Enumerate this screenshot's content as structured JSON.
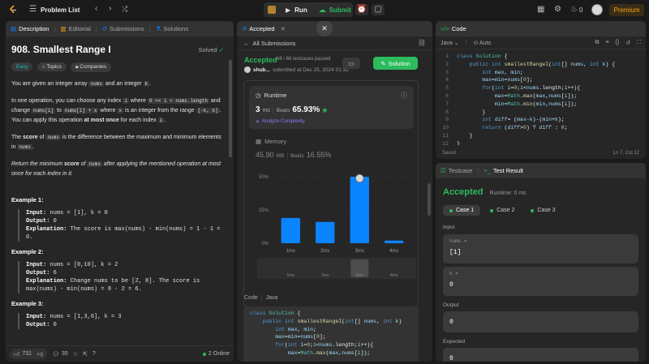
{
  "topbar": {
    "problem_list": "Problem List",
    "run": "Run",
    "submit": "Submit",
    "streak": "0",
    "premium": "Premium"
  },
  "left": {
    "tabs": [
      {
        "label": "Description"
      },
      {
        "label": "Editorial"
      },
      {
        "label": "Submissions"
      },
      {
        "label": "Solutions"
      }
    ],
    "title": "908. Smallest Range I",
    "status": "Solved",
    "chips": [
      "Easy",
      "Topics",
      "Companies"
    ],
    "p1": {
      "a": "You are given an integer array ",
      "b": "nums",
      "c": " and an integer ",
      "d": "k",
      "e": "."
    },
    "p2": {
      "a": "In one operation, you can choose any index ",
      "b": "i",
      "c": " where ",
      "d": "0 <= i < nums.length",
      "e": " and change ",
      "f": "nums[i]",
      "g": " to ",
      "h": "nums[i] + x",
      "i": " where ",
      "j": "x",
      "k": " is an integer from the range ",
      "l": "[-k, k]",
      "m": ". You can apply this operation ",
      "n": "at most once",
      "o": " for each index ",
      "p": "i",
      "q": "."
    },
    "p3": {
      "a": "The ",
      "b": "score",
      "c": " of ",
      "d": "nums",
      "e": " is the difference between the maximum and minimum elements in ",
      "f": "nums",
      "g": "."
    },
    "p4": {
      "a": "Return the minimum ",
      "b": "score",
      "c": " of ",
      "d": "nums",
      "e": " after applying the mentioned operation at most once for each index in it."
    },
    "examples": [
      {
        "title": "Example 1:",
        "input": "nums = [1], k = 0",
        "output": "0",
        "explanation": "The score is max(nums) - min(nums) = 1 - 1 = 0."
      },
      {
        "title": "Example 2:",
        "input": "nums = [0,10], k = 2",
        "output": "6",
        "explanation": "Change nums to be [2, 8]. The score is max(nums) - min(nums) = 8 - 2 = 6."
      },
      {
        "title": "Example 3:",
        "input": "nums = [1,3,6], k = 3",
        "output": "0",
        "explanation": ""
      }
    ],
    "footer": {
      "likes": "731",
      "comments": "35",
      "online": "2 Online"
    }
  },
  "mid": {
    "tab": "Accepted",
    "back": "All Submissions",
    "status": "Accepted",
    "passed": "68 / 68 testcases passed",
    "user": "shub...",
    "submitted": "submitted at Dec 25, 2024 01:32",
    "solution_btn": "Solution",
    "runtime": {
      "label": "Runtime",
      "value": "3",
      "unit": "ms",
      "beats_label": "Beats",
      "beats": "65.93%",
      "analyze": "Analyze Complexity"
    },
    "memory": {
      "label": "Memory",
      "value": "45.90",
      "unit": "MB",
      "beats_label": "Beats",
      "beats": "16.55%"
    },
    "code_header": {
      "label": "Code",
      "lang": "Java"
    },
    "code_lines": [
      "class Solution {",
      "    public int smallestRangeI(int[] nums, int k)",
      "        int max, min;",
      "        max=min=nums[0];",
      "        for(int i=0;i<nums.length;i++){",
      "            max=Math.max(max,nums[i]);"
    ]
  },
  "chart_data": {
    "type": "bar",
    "categories": [
      "1ms",
      "2ms",
      "3ms",
      "4ms"
    ],
    "values": [
      19,
      16,
      50,
      2
    ],
    "highlight": "3ms",
    "yticks": [
      "50%",
      "25%",
      "0%"
    ],
    "ylim": [
      0,
      50
    ],
    "minimap_labels": [
      "1ms",
      "2ms",
      "3ms",
      "4ms"
    ],
    "colors": {
      "bar": "#0a84ff",
      "grid": "#3a3a3a"
    }
  },
  "right_top": {
    "title": "Code",
    "lang": "Java",
    "mode": "Auto",
    "lines": [
      "class Solution {",
      "    public int smallestRangeI(int[] nums, int k) {",
      "        int max, min;",
      "        max=min=nums[0];",
      "        for(int i=0;i<nums.length;i++){",
      "            max=Math.max(max,nums[i]);",
      "            min=Math.min(min,nums[i]);",
      "        }",
      "        int diff= (max-k)-(min+k);",
      "        return (diff>0) ? diff : 0;",
      "    }",
      "}"
    ],
    "saved": "Saved",
    "position": "Ln 7, Col 12"
  },
  "right_bottom": {
    "tabs": [
      "Testcase",
      "Test Result"
    ],
    "status": "Accepted",
    "runtime": "Runtime: 0 ms",
    "cases": [
      "Case 1",
      "Case 2",
      "Case 3"
    ],
    "input_label": "Input",
    "nums_label": "nums =",
    "nums_value": "[1]",
    "k_label": "k =",
    "k_value": "0",
    "output_label": "Output",
    "output_value": "0",
    "expected_label": "Expected",
    "expected_value": "0"
  }
}
